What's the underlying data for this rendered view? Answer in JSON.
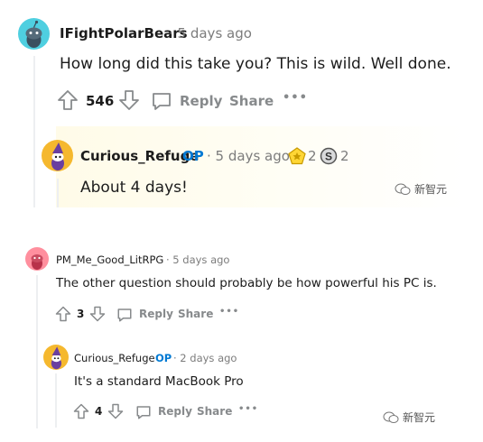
{
  "thread1": {
    "comment": {
      "username": "IFightPolarBears",
      "time": "· 5 days ago",
      "body": "How long did this take you? This is wild. Well done.",
      "score": "546",
      "reply_label": "Reply",
      "share_label": "Share",
      "more_label": "•••"
    },
    "reply": {
      "username": "Curious_Refuge",
      "op_badge": "OP",
      "time": "· 5 days ago",
      "award1_count": "2",
      "award2_count": "2",
      "body": "About 4 days!"
    }
  },
  "thread2": {
    "comment": {
      "username": "PM_Me_Good_LitRPG",
      "time": "· 5 days ago",
      "body": "The other question should probably be how powerful his PC is.",
      "score": "3",
      "reply_label": "Reply",
      "share_label": "Share",
      "more_label": "•••"
    },
    "reply": {
      "username": "Curious_Refuge",
      "op_badge": "OP",
      "time": "· 2 days ago",
      "body": "It's a standard MacBook Pro",
      "score": "4",
      "reply_label": "Reply",
      "share_label": "Share",
      "more_label": "•••"
    }
  },
  "watermark": {
    "text": "新智元"
  },
  "colors": {
    "op_blue": "#0079d3",
    "meta_gray": "#7c7c7c",
    "action_gray": "#878a8c",
    "thread_line": "#edeff1"
  }
}
